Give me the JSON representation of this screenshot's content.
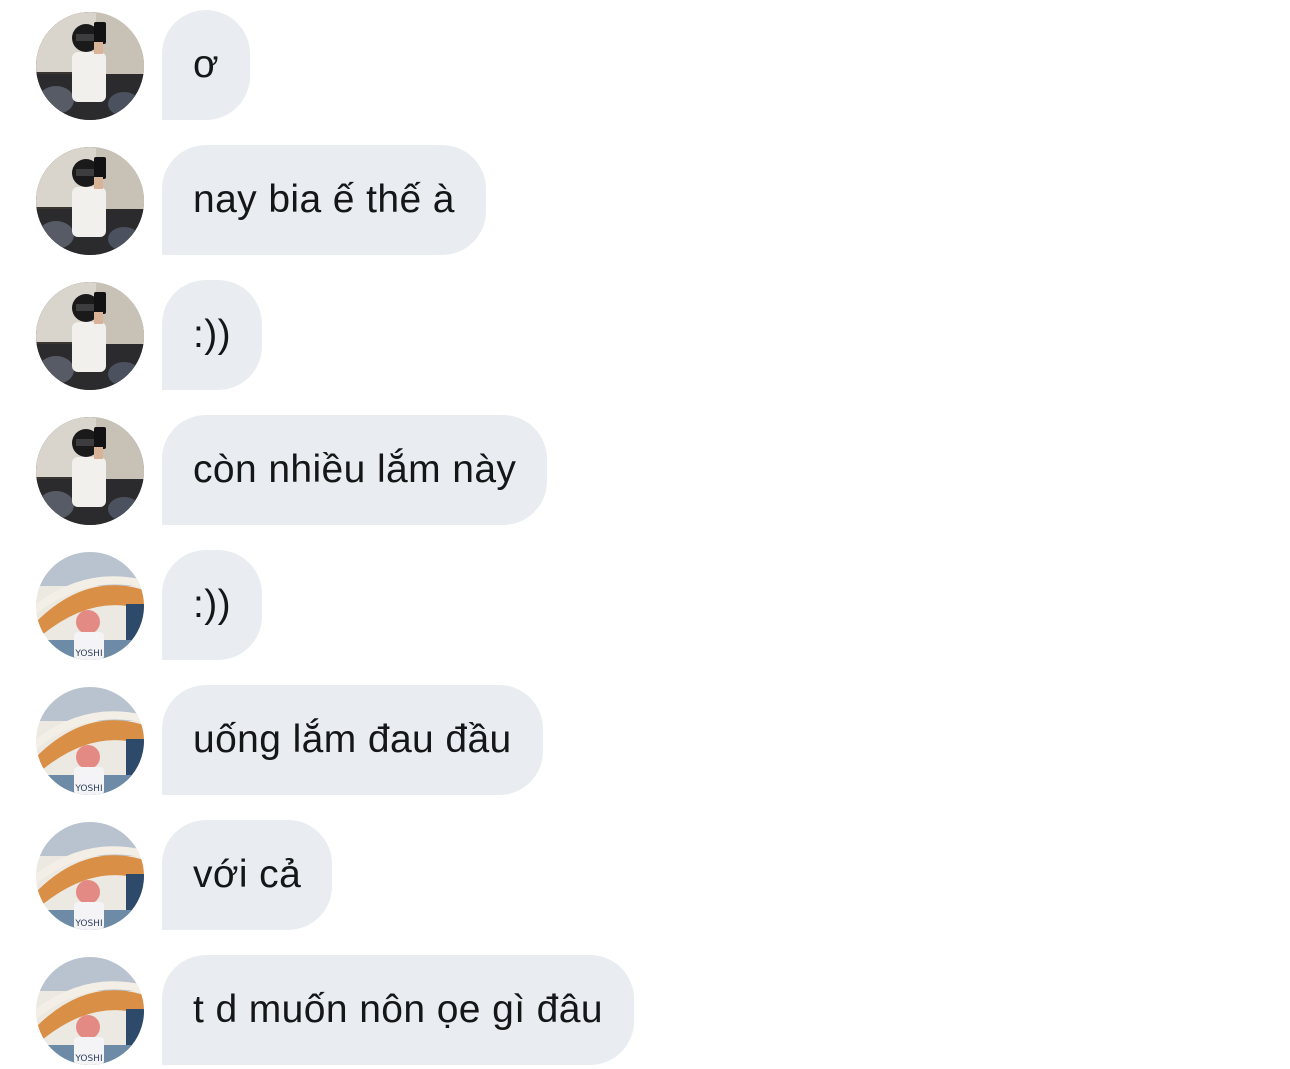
{
  "conversation": {
    "messages": [
      {
        "sender_avatar": "selfie-avatar",
        "text": "ơ"
      },
      {
        "sender_avatar": "selfie-avatar",
        "text": "nay bia ế thế à"
      },
      {
        "sender_avatar": "selfie-avatar",
        "text": ":))"
      },
      {
        "sender_avatar": "selfie-avatar",
        "text": "còn nhiều lắm này"
      },
      {
        "sender_avatar": "stadium-avatar",
        "text": ":))"
      },
      {
        "sender_avatar": "stadium-avatar",
        "text": "uống lắm đau đầu"
      },
      {
        "sender_avatar": "stadium-avatar",
        "text": "với cả"
      },
      {
        "sender_avatar": "stadium-avatar",
        "text": "t d muốn nôn ọe gì đâu"
      }
    ],
    "avatar_shirt_text": "YOSHI"
  },
  "colors": {
    "bubble_background": "#e9ecf0",
    "message_text": "#151617",
    "page_background": "#ffffff"
  }
}
